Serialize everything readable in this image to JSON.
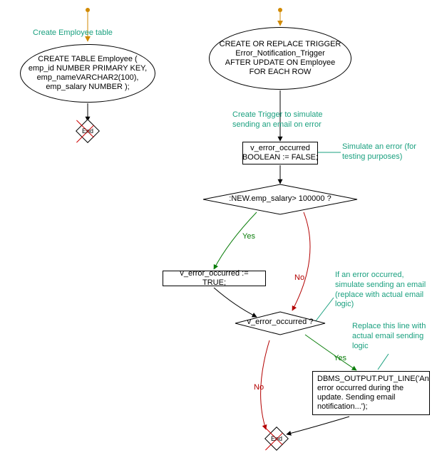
{
  "domain": "Diagram",
  "colors": {
    "annotation": "#1aa07f",
    "yes": "#0b7e0b",
    "no": "#b30000",
    "arrow_start": "#d18a00",
    "border": "#000000"
  },
  "left_flow": {
    "start_annot": "Create Employee table",
    "ellipse_lines": [
      "CREATE TABLE Employee (",
      "emp_id NUMBER PRIMARY KEY,",
      "emp_nameVARCHAR2(100),",
      "emp_salary NUMBER );"
    ],
    "end_label": "End"
  },
  "right_flow": {
    "ellipse_lines": [
      "CREATE OR REPLACE TRIGGER",
      "Error_Notification_Trigger",
      "AFTER UPDATE ON Employee",
      "FOR EACH ROW"
    ],
    "create_trigger_annot": "Create Trigger to simulate\nsending an email on error",
    "decl_box": "v_error_occurred\nBOOLEAN := FALSE;",
    "decl_annot": "Simulate an error (for\ntesting purposes)",
    "cond1": ":NEW.emp_salary> 100000 ?",
    "cond1_yes": "Yes",
    "cond1_no": "No",
    "set_true": "v_error_occurred := TRUE;",
    "cond2": "v_error_occurred ?",
    "cond2_annot": "If an error occurred,\nsimulate sending an email\n(replace with actual email\nlogic)",
    "cond2_yes": "Yes",
    "cond2_no": "No",
    "output_box": "DBMS_OUTPUT.PUT_LINE('An\nerror occurred during the\nupdate. Sending email\nnotification...');",
    "output_annot": "Replace this line with\nactual email sending\nlogic",
    "end_label": "End"
  },
  "chart_data": {
    "type": "flowchart",
    "nodes": [
      {
        "id": "L_start",
        "type": "start",
        "label": ""
      },
      {
        "id": "L_annot",
        "type": "annotation",
        "label": "Create Employee table"
      },
      {
        "id": "L_ellipse",
        "type": "process_ellipse",
        "label": "CREATE TABLE Employee ( emp_id NUMBER PRIMARY KEY, emp_nameVARCHAR2(100), emp_salary NUMBER );"
      },
      {
        "id": "L_end",
        "type": "end",
        "label": "End"
      },
      {
        "id": "R_start",
        "type": "start",
        "label": ""
      },
      {
        "id": "R_ellipse",
        "type": "process_ellipse",
        "label": "CREATE OR REPLACE TRIGGER Error_Notification_Trigger AFTER UPDATE ON Employee FOR EACH ROW"
      },
      {
        "id": "R_annot1",
        "type": "annotation",
        "label": "Create Trigger to simulate sending an email on error"
      },
      {
        "id": "R_decl",
        "type": "process",
        "label": "v_error_occurred BOOLEAN := FALSE;"
      },
      {
        "id": "R_annot2",
        "type": "annotation",
        "label": "Simulate an error (for testing purposes)"
      },
      {
        "id": "R_cond1",
        "type": "decision",
        "label": ":NEW.emp_salary> 100000 ?"
      },
      {
        "id": "R_setTrue",
        "type": "process",
        "label": "v_error_occurred := TRUE;"
      },
      {
        "id": "R_cond2",
        "type": "decision",
        "label": "v_error_occurred ?"
      },
      {
        "id": "R_annot3",
        "type": "annotation",
        "label": "If an error occurred, simulate sending an email (replace with actual email logic)"
      },
      {
        "id": "R_out",
        "type": "process",
        "label": "DBMS_OUTPUT.PUT_LINE('An error occurred during the update. Sending email notification...');"
      },
      {
        "id": "R_annot4",
        "type": "annotation",
        "label": "Replace this line with actual email sending logic"
      },
      {
        "id": "R_end",
        "type": "end",
        "label": "End"
      }
    ],
    "edges": [
      {
        "from": "L_start",
        "to": "L_ellipse",
        "label": "",
        "color": "default"
      },
      {
        "from": "L_ellipse",
        "to": "L_end",
        "label": "",
        "color": "default"
      },
      {
        "from": "R_start",
        "to": "R_ellipse",
        "label": "",
        "color": "default"
      },
      {
        "from": "R_ellipse",
        "to": "R_decl",
        "label": "",
        "color": "default"
      },
      {
        "from": "R_decl",
        "to": "R_cond1",
        "label": "",
        "color": "default"
      },
      {
        "from": "R_cond1",
        "to": "R_setTrue",
        "label": "Yes",
        "color": "yes"
      },
      {
        "from": "R_cond1",
        "to": "R_cond2",
        "label": "No",
        "color": "no"
      },
      {
        "from": "R_setTrue",
        "to": "R_cond2",
        "label": "",
        "color": "default"
      },
      {
        "from": "R_cond2",
        "to": "R_out",
        "label": "Yes",
        "color": "yes"
      },
      {
        "from": "R_cond2",
        "to": "R_end",
        "label": "No",
        "color": "no"
      },
      {
        "from": "R_out",
        "to": "R_end",
        "label": "",
        "color": "default"
      }
    ]
  }
}
